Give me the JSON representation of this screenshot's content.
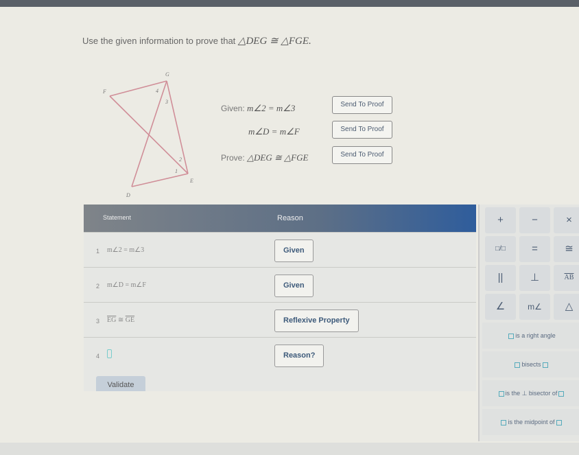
{
  "prompt": {
    "text": "Use the given information to prove that",
    "expr": "△DEG ≅ △FGE."
  },
  "diagram": {
    "labels": {
      "G": "G",
      "F": "F",
      "E": "E",
      "D": "D",
      "a1": "1",
      "a2": "2",
      "a3": "3",
      "a4": "4"
    }
  },
  "given": {
    "label": "Given:",
    "g1": "m∠2 = m∠3",
    "g2": "m∠D = m∠F",
    "prove_label": "Prove:",
    "prove": "△DEG ≅ △FGE",
    "send": "Send To Proof"
  },
  "table": {
    "headers": {
      "statement": "Statement",
      "reason": "Reason"
    },
    "rows": [
      {
        "num": "1",
        "statement": "m∠2 = m∠3",
        "reason": "Given"
      },
      {
        "num": "2",
        "statement": "m∠D = m∠F",
        "reason": "Given"
      },
      {
        "num": "3",
        "seg1": "EG",
        "rel": "≅",
        "seg2": "GE",
        "reason": "Reflexive Property"
      },
      {
        "num": "4",
        "statement": "",
        "reason": "Reason?"
      }
    ],
    "validate": "Validate"
  },
  "palette": {
    "symbols": [
      "+",
      "−",
      "×",
      "□/□",
      "=",
      "≅",
      "||",
      "⊥",
      "AB",
      "∠",
      "m∠",
      "△"
    ],
    "phrases": {
      "right_angle": "is a right angle",
      "bisects": "bisects",
      "perp_bisector": "is the ⊥ bisector of",
      "midpoint": "is the midpoint of"
    }
  }
}
